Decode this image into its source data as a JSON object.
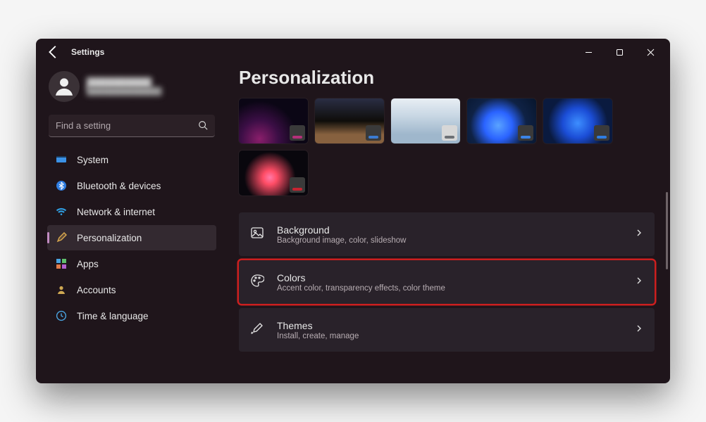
{
  "titlebar": {
    "title": "Settings"
  },
  "profile": {
    "name": "██████████",
    "email": "███████████████"
  },
  "search": {
    "placeholder": "Find a setting"
  },
  "sidebar": {
    "items": [
      {
        "label": "System"
      },
      {
        "label": "Bluetooth & devices"
      },
      {
        "label": "Network & internet"
      },
      {
        "label": "Personalization"
      },
      {
        "label": "Apps"
      },
      {
        "label": "Accounts"
      },
      {
        "label": "Time & language"
      }
    ],
    "active_index": 3
  },
  "main": {
    "heading": "Personalization",
    "rows": [
      {
        "title": "Background",
        "subtitle": "Background image, color, slideshow"
      },
      {
        "title": "Colors",
        "subtitle": "Accent color, transparency effects, color theme"
      },
      {
        "title": "Themes",
        "subtitle": "Install, create, manage"
      }
    ],
    "highlight_row_index": 1
  }
}
